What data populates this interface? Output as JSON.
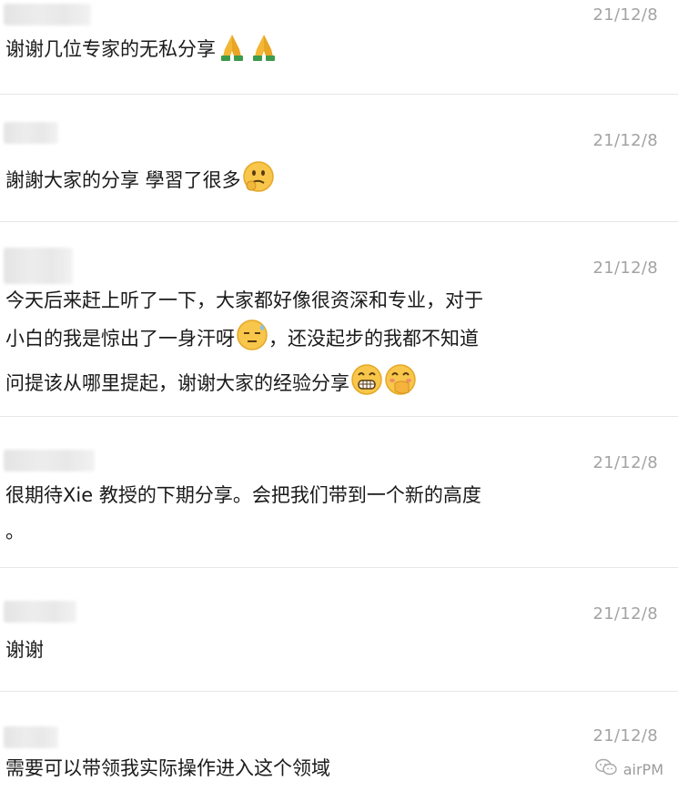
{
  "comments": [
    {
      "date": "21/12/8",
      "text": "谢谢几位专家的无私分享"
    },
    {
      "date": "21/12/8",
      "text": "謝謝大家的分享 學習了很多"
    },
    {
      "date": "21/12/8",
      "lines": [
        "今天后来赶上听了一下，大家都好像很资深和专业，对于",
        "小白的我是惊出了一身汗呀",
        "，还没起步的我都不知道",
        "问提该从哪里提起，谢谢大家的经验分享"
      ]
    },
    {
      "date": "21/12/8",
      "lines": [
        "很期待Xie 教授的下期分享。会把我们带到一个新的高度",
        "。"
      ]
    },
    {
      "date": "21/12/8",
      "text": "谢谢"
    },
    {
      "date": "21/12/8",
      "text": "需要可以带领我实际操作进入这个领域"
    }
  ],
  "watermark": {
    "text": "airPM"
  },
  "icons": {
    "pray": "folded-hands-emoji",
    "thinking": "thinking-face-emoji",
    "sweat": "downcast-sweat-emoji",
    "grin": "grinning-emoji",
    "blush": "hand-over-mouth-emoji"
  }
}
